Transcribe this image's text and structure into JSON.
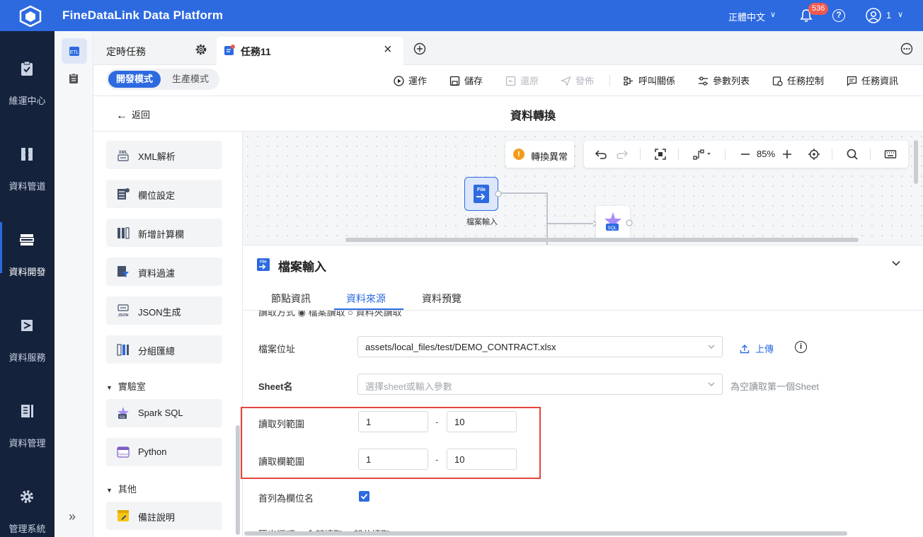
{
  "app": {
    "title": "FineDataLink Data Platform"
  },
  "header": {
    "language": "正體中文",
    "notification_count": "536",
    "user_name": "1"
  },
  "nav": {
    "items": [
      {
        "label": "維運中心"
      },
      {
        "label": "資料管道"
      },
      {
        "label": "資料開發"
      },
      {
        "label": "資料服務"
      },
      {
        "label": "資料管理"
      },
      {
        "label": "管理系統"
      }
    ],
    "active": "資料開發",
    "expand_glyph": "»"
  },
  "tabs": {
    "scheduled": "定時任務",
    "task": "任務11"
  },
  "toolbar": {
    "mode_dev": "開發模式",
    "mode_prod": "生產模式",
    "run": "運作",
    "save": "儲存",
    "revert": "還原",
    "publish": "發佈",
    "call_relation": "呼叫關係",
    "param_list": "參數列表",
    "task_control": "任務控制",
    "task_info": "任務資訊"
  },
  "page": {
    "back": "返回",
    "title": "資料轉換"
  },
  "operators": {
    "items": [
      {
        "label": "XML解析",
        "icon": "xml-icon"
      },
      {
        "label": "欄位設定",
        "icon": "field-setting-icon"
      },
      {
        "label": "新增計算欄",
        "icon": "calc-column-icon"
      },
      {
        "label": "資料過濾",
        "icon": "filter-icon"
      },
      {
        "label": "JSON生成",
        "icon": "json-icon"
      },
      {
        "label": "分組匯總",
        "icon": "group-summary-icon"
      }
    ],
    "lab_section": "實驗室",
    "lab_items": [
      {
        "label": "Spark SQL",
        "icon": "spark-sql-icon"
      },
      {
        "label": "Python",
        "icon": "python-icon"
      }
    ],
    "other_section": "其他",
    "other_items": [
      {
        "label": "備註說明",
        "icon": "note-icon"
      }
    ]
  },
  "canvas": {
    "warning": "轉換異常",
    "zoom": "85%",
    "node_file_label": "檔案輸入",
    "node_file_badge": "File",
    "node_sql_badge": "SQL"
  },
  "panel": {
    "title": "檔案輸入",
    "title_badge": "File",
    "tabs": [
      "節點資訊",
      "資料來源",
      "資料預覽"
    ],
    "active_tab": "資料來源",
    "clipped_row": "讀取方式      ◉ 檔案讀取     ○ 資料夾讀取",
    "file_location_label": "檔案位址",
    "file_location_value": "assets/local_files/test/DEMO_CONTRACT.xlsx",
    "upload_label": "上傳",
    "sheet_label": "Sheet名",
    "sheet_placeholder": "選擇sheet或輸入參數",
    "sheet_hint": "為空讀取第一個Sheet",
    "row_range_label": "讀取列範圍",
    "row_range_from": "1",
    "row_range_to": "10",
    "col_range_label": "讀取欄範圍",
    "col_range_from": "1",
    "col_range_to": "10",
    "range_dash": "-",
    "first_row_header_label": "首列為欄位名",
    "first_row_header_checked": true,
    "clipped_bottom": "匯出選項      ○ 全部讀取    ○ 部分讀取"
  },
  "colors": {
    "brand": "#2d6ae0",
    "nav_bg": "#15223b",
    "highlight": "#e5453f"
  }
}
